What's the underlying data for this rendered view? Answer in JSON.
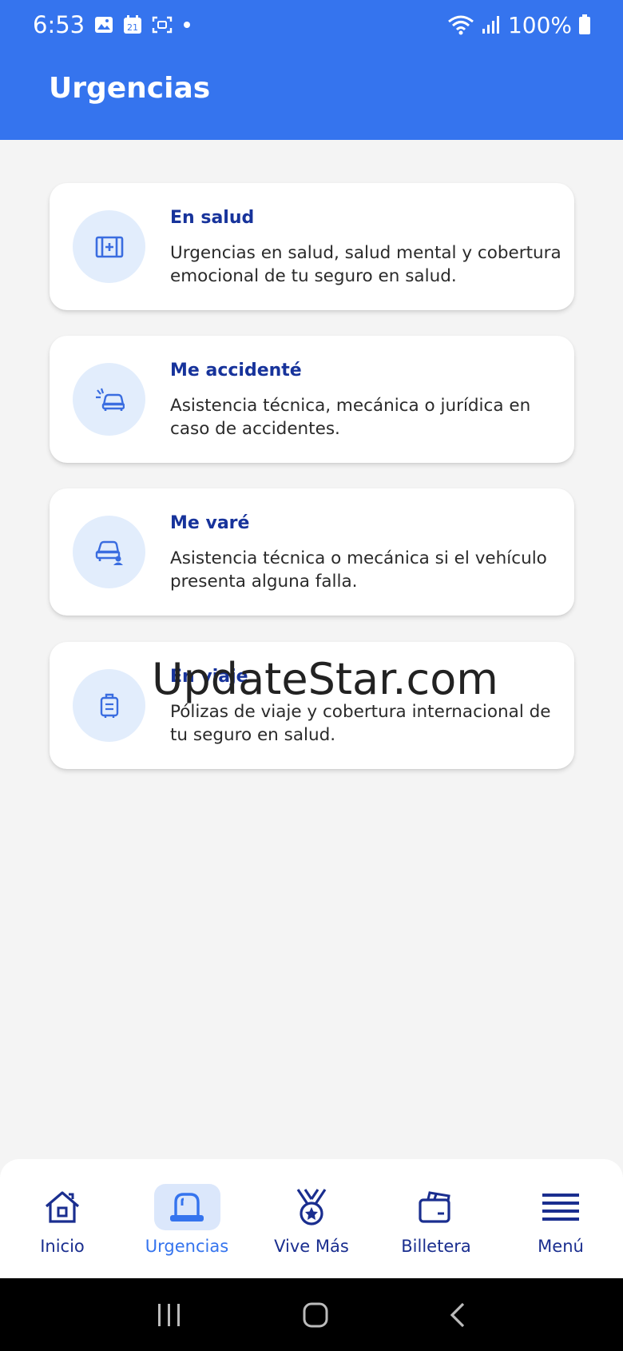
{
  "status_bar": {
    "time": "6:53",
    "calendar_day": "21",
    "battery": "100%"
  },
  "header": {
    "title": "Urgencias"
  },
  "cards": [
    {
      "icon": "first-aid-kit-icon",
      "title": "En salud",
      "description": "Urgencias en salud, salud mental y cobertura emocional de tu seguro en salud."
    },
    {
      "icon": "car-crash-icon",
      "title": "Me accidenté",
      "description": "Asistencia técnica, mecánica o jurídica en caso de accidentes."
    },
    {
      "icon": "car-breakdown-icon",
      "title": "Me varé",
      "description": "Asistencia técnica o mecánica si el vehículo presenta alguna falla."
    },
    {
      "icon": "luggage-icon",
      "title": "En viaje",
      "description": "Pólizas de viaje y cobertura internacional de tu seguro en salud."
    }
  ],
  "watermark": "UpdateStar.com",
  "bottom_nav": {
    "items": [
      {
        "label": "Inicio",
        "icon": "home-icon",
        "active": false
      },
      {
        "label": "Urgencias",
        "icon": "siren-icon",
        "active": true
      },
      {
        "label": "Vive Más",
        "icon": "medal-icon",
        "active": false
      },
      {
        "label": "Billetera",
        "icon": "wallet-icon",
        "active": false
      },
      {
        "label": "Menú",
        "icon": "menu-icon",
        "active": false
      }
    ]
  },
  "colors": {
    "header_bg": "#3574ee",
    "title_blue": "#17339b",
    "icon_circle": "#e2edfc",
    "nav_active_bg": "#dbe7fb"
  }
}
